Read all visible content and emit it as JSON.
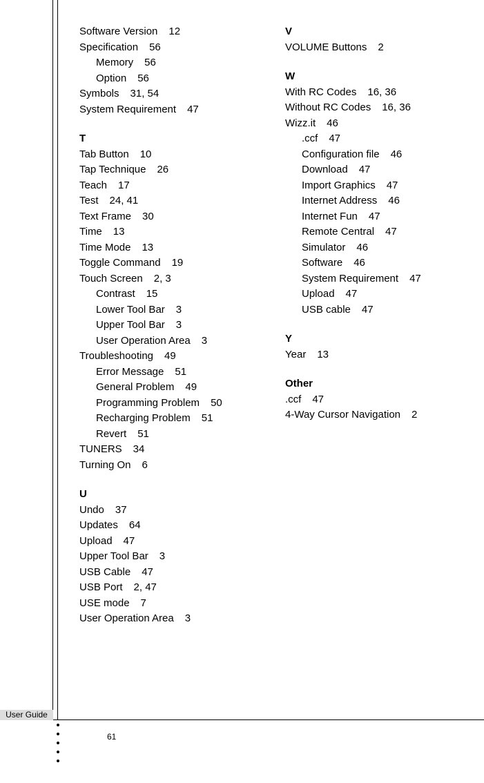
{
  "footer_label": "User Guide",
  "page_number": "61",
  "col1": [
    {
      "heading": null,
      "items": [
        {
          "term": "Software Version",
          "pages": "12"
        },
        {
          "term": "Specification",
          "pages": "56"
        },
        {
          "term": "Memory",
          "pages": "56",
          "indent": true
        },
        {
          "term": "Option",
          "pages": "56",
          "indent": true
        },
        {
          "term": "Symbols",
          "pages": "31, 54"
        },
        {
          "term": "System Requirement",
          "pages": "47"
        }
      ]
    },
    {
      "heading": "T",
      "items": [
        {
          "term": "Tab Button",
          "pages": "10"
        },
        {
          "term": "Tap Technique",
          "pages": "26"
        },
        {
          "term": "Teach",
          "pages": "17"
        },
        {
          "term": "Test",
          "pages": "24, 41"
        },
        {
          "term": "Text Frame",
          "pages": "30"
        },
        {
          "term": "Time",
          "pages": "13"
        },
        {
          "term": "Time Mode",
          "pages": "13"
        },
        {
          "term": "Toggle Command",
          "pages": "19"
        },
        {
          "term": "Touch Screen",
          "pages": "2, 3"
        },
        {
          "term": "Contrast",
          "pages": "15",
          "indent": true
        },
        {
          "term": "Lower Tool Bar",
          "pages": "3",
          "indent": true
        },
        {
          "term": "Upper Tool Bar",
          "pages": "3",
          "indent": true
        },
        {
          "term": "User Operation Area",
          "pages": "3",
          "indent": true
        },
        {
          "term": "Troubleshooting",
          "pages": "49"
        },
        {
          "term": "Error Message",
          "pages": "51",
          "indent": true
        },
        {
          "term": "General Problem",
          "pages": "49",
          "indent": true
        },
        {
          "term": "Programming Problem",
          "pages": "50",
          "indent": true
        },
        {
          "term": "Recharging Problem",
          "pages": "51",
          "indent": true
        },
        {
          "term": "Revert",
          "pages": "51",
          "indent": true
        },
        {
          "term": "TUNERS",
          "pages": "34"
        },
        {
          "term": "Turning On",
          "pages": "6"
        }
      ]
    },
    {
      "heading": "U",
      "items": [
        {
          "term": "Undo",
          "pages": "37"
        },
        {
          "term": "Updates",
          "pages": "64"
        },
        {
          "term": "Upload",
          "pages": "47"
        },
        {
          "term": "Upper Tool Bar",
          "pages": "3"
        },
        {
          "term": "USB Cable",
          "pages": "47"
        },
        {
          "term": "USB Port",
          "pages": "2, 47"
        },
        {
          "term": "USE mode",
          "pages": "7"
        },
        {
          "term": "User Operation Area",
          "pages": "3"
        }
      ]
    }
  ],
  "col2": [
    {
      "heading": "V",
      "items": [
        {
          "term": "VOLUME Buttons",
          "pages": "2"
        }
      ]
    },
    {
      "heading": "W",
      "items": [
        {
          "term": "With RC Codes",
          "pages": "16, 36"
        },
        {
          "term": "Without RC Codes",
          "pages": "16, 36"
        },
        {
          "term": "Wizz.it",
          "pages": "46"
        },
        {
          "term": ".ccf",
          "pages": "47",
          "indent": true
        },
        {
          "term": "Configuration file",
          "pages": "46",
          "indent": true
        },
        {
          "term": "Download",
          "pages": "47",
          "indent": true
        },
        {
          "term": "Import Graphics",
          "pages": "47",
          "indent": true
        },
        {
          "term": "Internet Address",
          "pages": "46",
          "indent": true
        },
        {
          "term": "Internet Fun",
          "pages": "47",
          "indent": true
        },
        {
          "term": "Remote Central",
          "pages": "47",
          "indent": true
        },
        {
          "term": "Simulator",
          "pages": "46",
          "indent": true
        },
        {
          "term": "Software",
          "pages": "46",
          "indent": true
        },
        {
          "term": "System Requirement",
          "pages": "47",
          "indent": true
        },
        {
          "term": "Upload",
          "pages": "47",
          "indent": true
        },
        {
          "term": "USB cable",
          "pages": "47",
          "indent": true
        }
      ]
    },
    {
      "heading": "Y",
      "items": [
        {
          "term": "Year",
          "pages": "13"
        }
      ]
    },
    {
      "heading": "Other",
      "items": [
        {
          "term": ".ccf",
          "pages": "47"
        },
        {
          "term": "4-Way Cursor Navigation",
          "pages": "2"
        }
      ]
    }
  ]
}
